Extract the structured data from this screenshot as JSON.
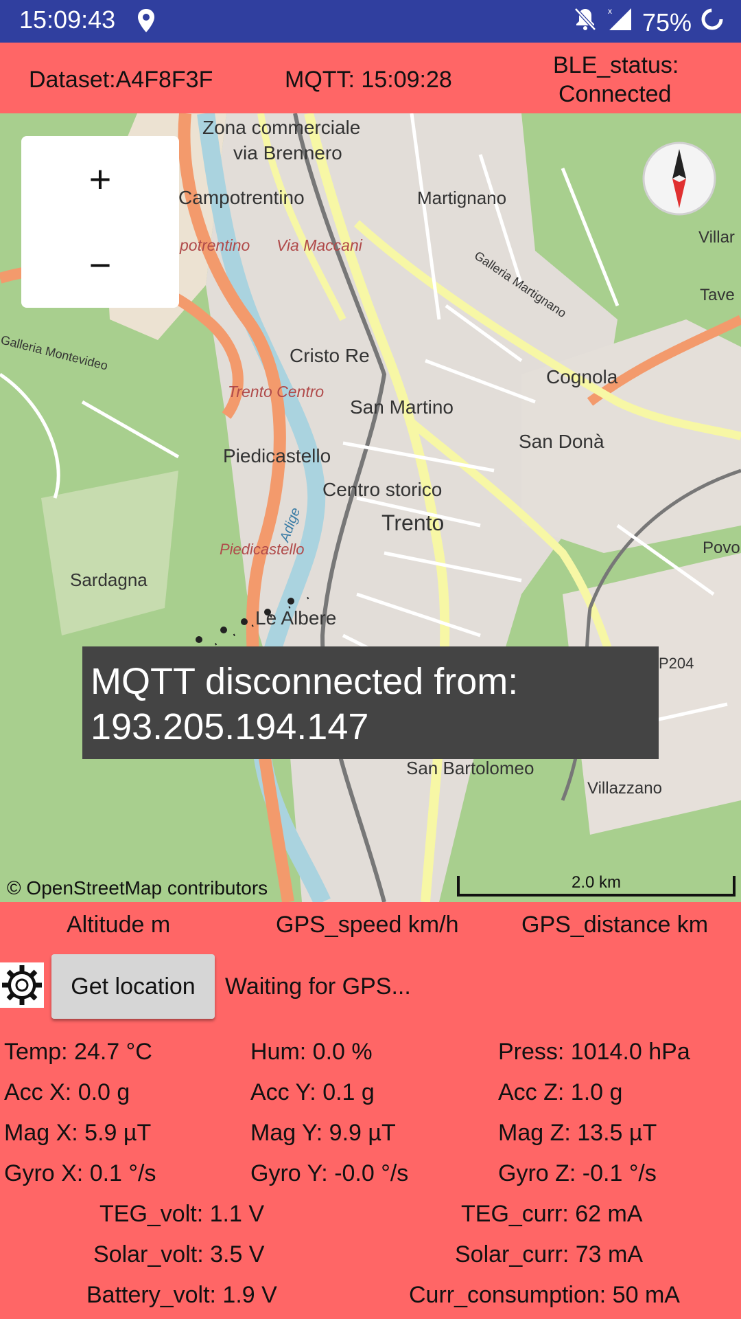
{
  "status_bar": {
    "time": "15:09:43",
    "battery_percent": "75%",
    "icons": [
      "location-icon",
      "notifications-off-icon",
      "signal-icon",
      "battery-loading-icon"
    ]
  },
  "header": {
    "dataset": "Dataset:A4F8F3F",
    "mqtt": "MQTT: 15:09:28",
    "ble_label": "BLE_status:",
    "ble_value": "Connected"
  },
  "map": {
    "zoom_in": "+",
    "zoom_out": "−",
    "toast_line1": "MQTT disconnected from:",
    "toast_line2": "193.205.194.147",
    "attribution": "© OpenStreetMap contributors",
    "scale_label": "2.0 km",
    "place_labels": [
      "Zona commerciale",
      "via Brennero",
      "Campotrentino",
      "Martignano",
      "potrentino",
      "Via Maccani",
      "Cristo Re",
      "Cognola",
      "Trento Centro",
      "San Martino",
      "San Donà",
      "Piedicastello",
      "Centro storico",
      "Trento",
      "Sardagna",
      "Piedicastello",
      "Le Albere",
      "San Bartolomeo",
      "Villazzano",
      "P204",
      "Villar",
      "Tave",
      "Povo",
      "Galleria Montevideo",
      "Galleria Martignano",
      "Adige"
    ]
  },
  "gps_labels": {
    "altitude": "Altitude m",
    "speed": "GPS_speed km/h",
    "distance": "GPS_distance km"
  },
  "controls": {
    "get_location": "Get location",
    "waiting": "Waiting for GPS..."
  },
  "sensors": {
    "temp": "Temp: 24.7  °C",
    "hum": "Hum: 0.0  %",
    "press": "Press: 1014.0  hPa",
    "acc_x": "Acc X: 0.0  g",
    "acc_y": "Acc Y: 0.1  g",
    "acc_z": "Acc Z: 1.0  g",
    "mag_x": "Mag X: 5.9  µT",
    "mag_y": "Mag Y: 9.9  µT",
    "mag_z": "Mag Z: 13.5  µT",
    "gyro_x": "Gyro X: 0.1  °/s",
    "gyro_y": "Gyro Y: -0.0  °/s",
    "gyro_z": "Gyro Z: -0.1  °/s",
    "teg_volt": "TEG_volt: 1.1  V",
    "teg_curr": "TEG_curr: 62  mA",
    "solar_volt": "Solar_volt: 3.5  V",
    "solar_curr": "Solar_curr: 73  mA",
    "battery_volt": "Battery_volt: 1.9 V",
    "curr_consumption": "Curr_consumption: 50  mA"
  }
}
